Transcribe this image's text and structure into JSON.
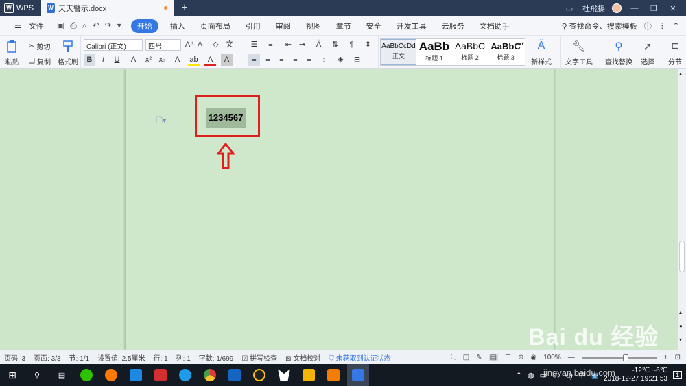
{
  "titlebar": {
    "app_tab": "WPS",
    "doc_tab": "天天警示.docx",
    "new_tab_symbol": "+",
    "username": "杜飛揚",
    "app_icon_letter": "W"
  },
  "menubar": {
    "file_label": "文件",
    "tabs": [
      "开始",
      "插入",
      "页面布局",
      "引用",
      "审阅",
      "视图",
      "章节",
      "安全",
      "开发工具",
      "云服务",
      "文档助手"
    ],
    "search_label": "查找命令、搜索模板"
  },
  "ribbon": {
    "paste_label": "粘贴",
    "cut_label": "剪切",
    "copy_label": "复制",
    "format_painter_label": "格式刷",
    "font_name": "Calibri (正文)",
    "font_size": "四号",
    "styles": [
      {
        "sample": "AaBbCcDd",
        "name": "正文"
      },
      {
        "sample": "AaBb",
        "name": "标题 1"
      },
      {
        "sample": "AaBbC",
        "name": "标题 2"
      },
      {
        "sample": "AaBbC",
        "name": "标题 3"
      }
    ],
    "new_style_label": "新样式",
    "text_tools_label": "文字工具",
    "find_replace_label": "查找替换",
    "select_label": "选择",
    "section_label": "分节"
  },
  "document": {
    "selected_text": "1234567"
  },
  "statusbar": {
    "page_num": "页码: 3",
    "pages": "页面: 3/3",
    "section": "节: 1/1",
    "setting_value": "设置值: 2.5厘米",
    "row": "行: 1",
    "col": "列: 1",
    "word_count": "字数: 1/699",
    "spell_check": "拼写检查",
    "doc_proof": "文档校对",
    "auth_status": "未获取到认证状态",
    "zoom": "100%"
  },
  "taskbar": {
    "temperature": "-12℃~-6℃",
    "ime": "中",
    "date": "2018-12-27",
    "time": "19:21:53",
    "notifications": "1"
  },
  "watermark": {
    "brand": "Bai du 经验",
    "url": "jingyan.baidu.com"
  },
  "colors": {
    "accent": "#3578e5",
    "highlight_box": "#e01e1e",
    "page_bg": "#cde6c9",
    "selection": "#9fb99b"
  }
}
